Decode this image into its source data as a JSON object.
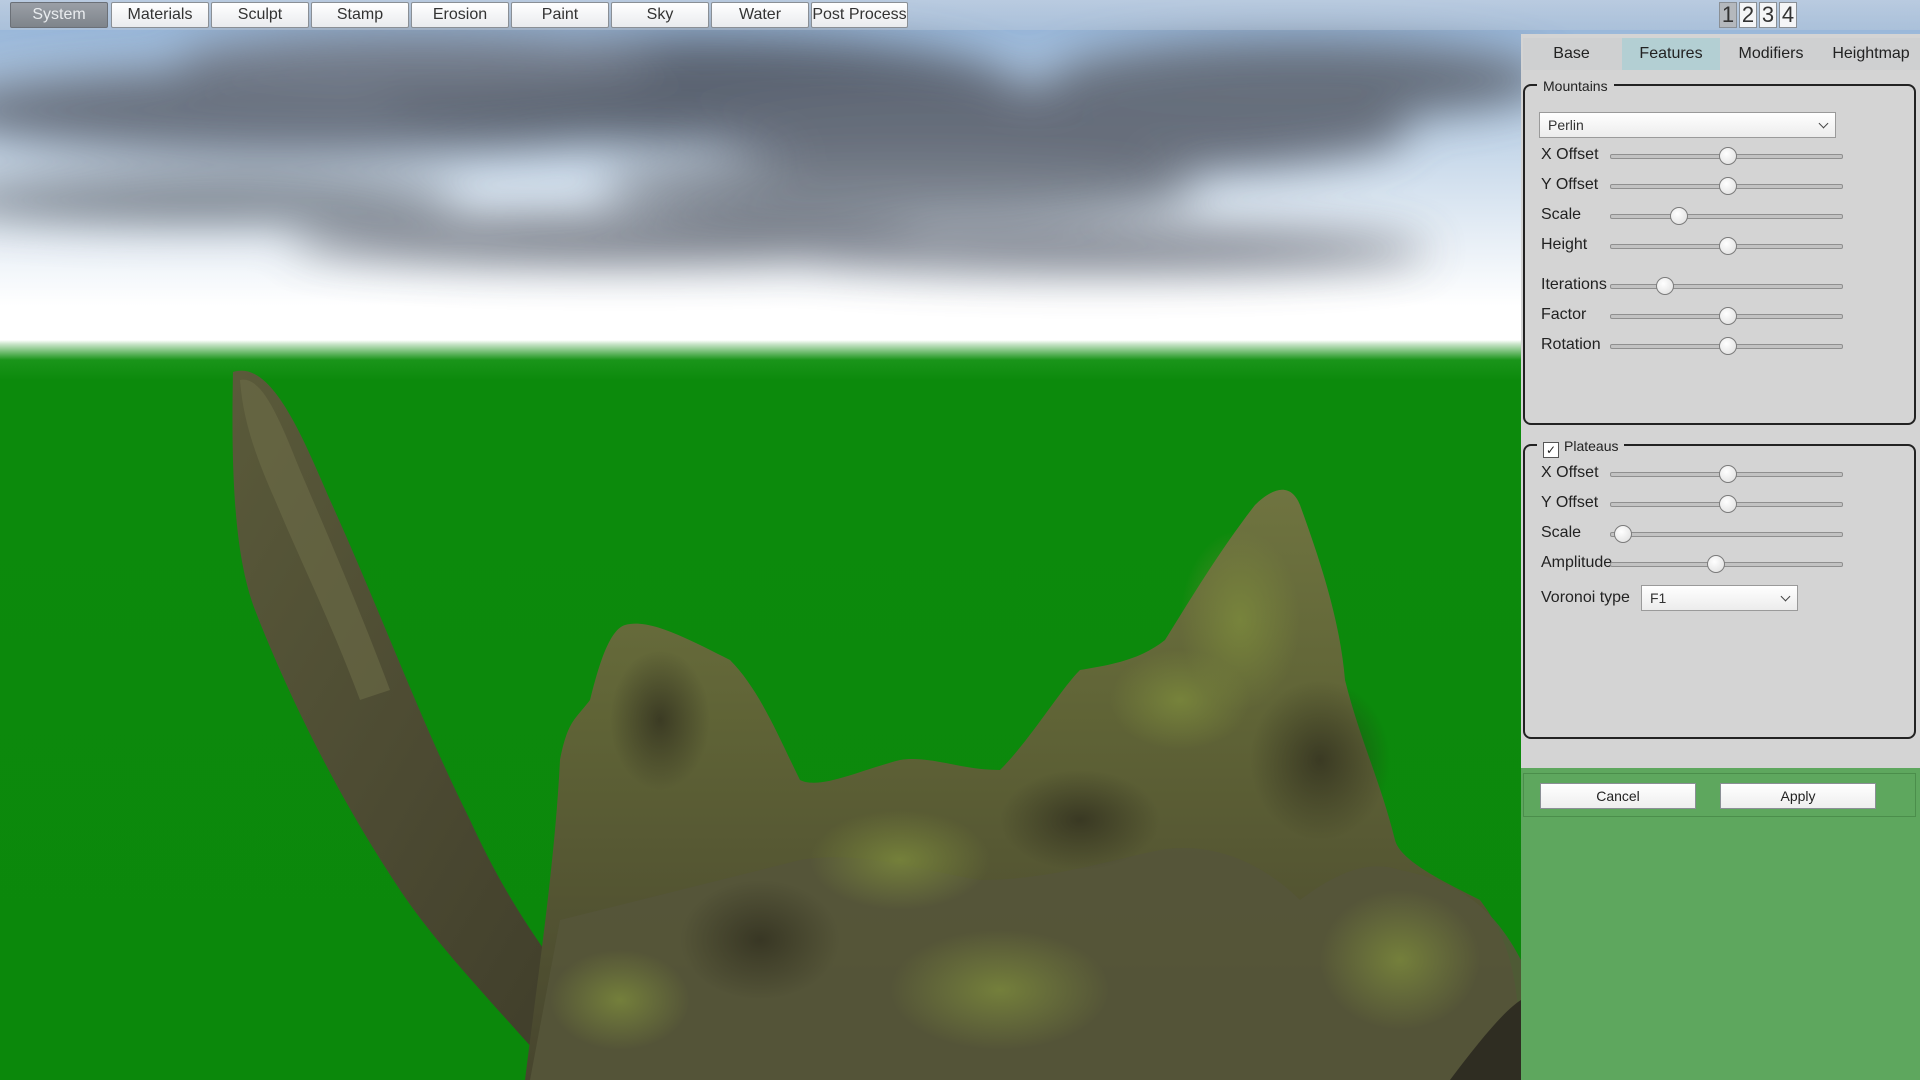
{
  "toolbar": {
    "tabs": [
      {
        "label": "System",
        "active": true
      },
      {
        "label": "Materials"
      },
      {
        "label": "Sculpt"
      },
      {
        "label": "Stamp"
      },
      {
        "label": "Erosion"
      },
      {
        "label": "Paint"
      },
      {
        "label": "Sky"
      },
      {
        "label": "Water"
      },
      {
        "label": "Post Process"
      }
    ],
    "views": [
      "1",
      "2",
      "3",
      "4"
    ],
    "active_view": "1"
  },
  "panel": {
    "tabs": [
      {
        "label": "Base"
      },
      {
        "label": "Features",
        "active": true
      },
      {
        "label": "Modifiers"
      },
      {
        "label": "Heightmap"
      }
    ],
    "mountains": {
      "title": "Mountains",
      "noise_type": "Perlin",
      "sliders": [
        {
          "label": "X Offset",
          "value": 0.5
        },
        {
          "label": "Y Offset",
          "value": 0.5
        },
        {
          "label": "Scale",
          "value": 0.29
        },
        {
          "label": "Height",
          "value": 0.5
        },
        {
          "label": "Iterations",
          "value": 0.23
        },
        {
          "label": "Factor",
          "value": 0.5
        },
        {
          "label": "Rotation",
          "value": 0.5
        }
      ]
    },
    "plateaus": {
      "title": "Plateaus",
      "enabled": true,
      "sliders": [
        {
          "label": "X Offset",
          "value": 0.5
        },
        {
          "label": "Y Offset",
          "value": 0.5
        },
        {
          "label": "Scale",
          "value": 0.05
        },
        {
          "label": "Amplitude",
          "value": 0.45
        }
      ],
      "voronoi_label": "Voronoi type",
      "voronoi_value": "F1"
    },
    "actions": {
      "cancel": "Cancel",
      "apply": "Apply"
    }
  },
  "colors": {
    "ground": "#0c8a0c",
    "panel_bg": "#d4d4d4",
    "panel_lower": "#5ea75e",
    "tab_active": "#b3cfd3"
  }
}
